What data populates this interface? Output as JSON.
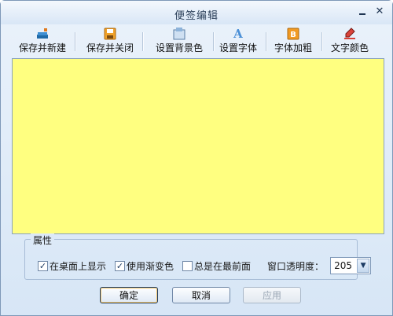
{
  "window": {
    "title": "便签编辑"
  },
  "toolbar": {
    "buttons": [
      {
        "label": "保存并新建",
        "icon": "save-new-icon"
      },
      {
        "label": "保存并关闭",
        "icon": "save-close-icon"
      },
      {
        "label": "设置背景色",
        "icon": "background-color-icon"
      },
      {
        "label": "设置字体",
        "icon": "font-icon"
      },
      {
        "label": "字体加粗",
        "icon": "bold-icon"
      },
      {
        "label": "文字颜色",
        "icon": "text-color-icon"
      }
    ]
  },
  "editor": {
    "content": "",
    "background_color": "#FFFF80"
  },
  "properties": {
    "legend": "属性",
    "options": [
      {
        "label": "在桌面上显示",
        "checked": true
      },
      {
        "label": "使用渐变色",
        "checked": true
      },
      {
        "label": "总是在最前面",
        "checked": false
      }
    ],
    "transparency_label": "窗口透明度：",
    "transparency_value": "205"
  },
  "actions": {
    "ok": "确定",
    "cancel": "取消",
    "apply": "应用"
  },
  "colors": {
    "accent": "#7E98B8",
    "editor_bg": "#FFFF80"
  }
}
